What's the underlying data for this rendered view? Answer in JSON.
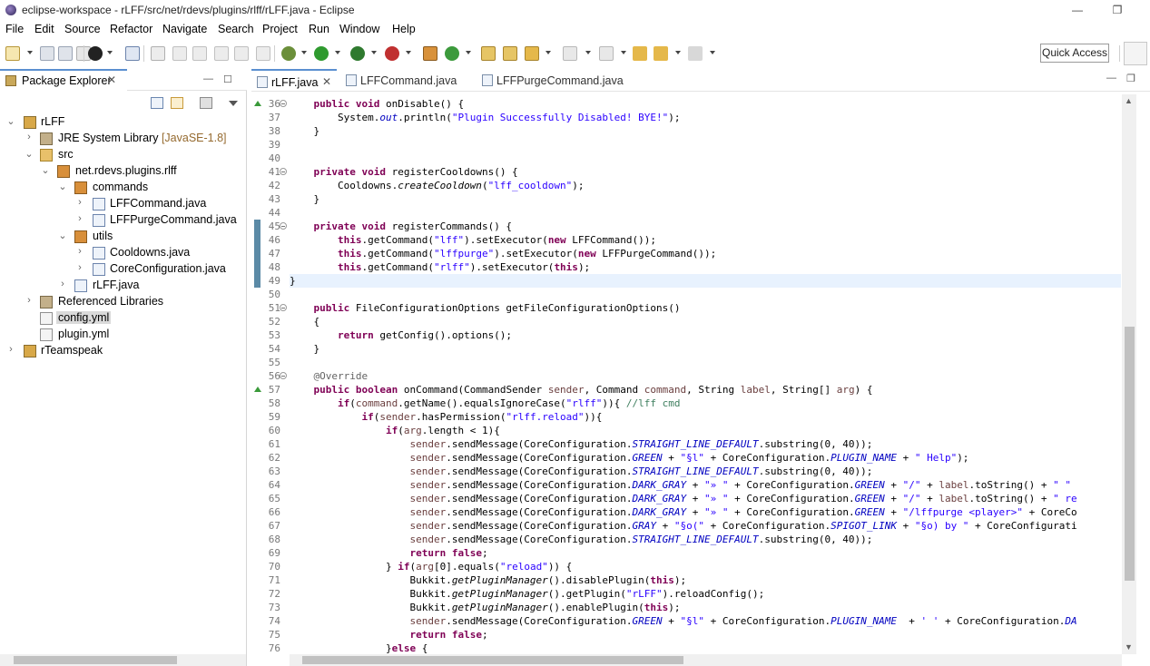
{
  "window": {
    "title": "eclipse-workspace - rLFF/src/net/rdevs/plugins/rlff/rLFF.java - Eclipse",
    "minimize": "—",
    "maximize": "❐"
  },
  "menu": [
    "File",
    "Edit",
    "Source",
    "Refactor",
    "Navigate",
    "Search",
    "Project",
    "Run",
    "Window",
    "Help"
  ],
  "toolbar": {
    "quick_access": "Quick Access"
  },
  "package_explorer": {
    "tab_label": "Package Explorer",
    "close": "✕",
    "minimize": "—",
    "maximize": "☐",
    "tree": [
      {
        "label": "rLFF",
        "deco": "",
        "arrow": "⌄",
        "icon": "project"
      },
      {
        "label": "JRE System Library",
        "deco": "[JavaSE-1.8]",
        "arrow": "›",
        "icon": "library"
      },
      {
        "label": "src",
        "deco": "",
        "arrow": "⌄",
        "icon": "source-folder"
      },
      {
        "label": "net.rdevs.plugins.rlff",
        "deco": "",
        "arrow": "⌄",
        "icon": "package"
      },
      {
        "label": "commands",
        "deco": "",
        "arrow": "⌄",
        "icon": "package"
      },
      {
        "label": "LFFCommand.java",
        "deco": "",
        "arrow": "›",
        "icon": "java-file"
      },
      {
        "label": "LFFPurgeCommand.java",
        "deco": "",
        "arrow": "›",
        "icon": "java-file"
      },
      {
        "label": "utils",
        "deco": "",
        "arrow": "⌄",
        "icon": "package"
      },
      {
        "label": "Cooldowns.java",
        "deco": "",
        "arrow": "›",
        "icon": "java-file"
      },
      {
        "label": "CoreConfiguration.java",
        "deco": "",
        "arrow": "›",
        "icon": "java-file"
      },
      {
        "label": "rLFF.java",
        "deco": "",
        "arrow": "›",
        "icon": "java-file"
      },
      {
        "label": "Referenced Libraries",
        "deco": "",
        "arrow": "›",
        "icon": "library"
      },
      {
        "label": "config.yml",
        "deco": "",
        "arrow": "",
        "icon": "yml-file"
      },
      {
        "label": "plugin.yml",
        "deco": "",
        "arrow": "",
        "icon": "yml-file"
      },
      {
        "label": "rTeamspeak",
        "deco": "",
        "arrow": "›",
        "icon": "project"
      }
    ]
  },
  "editor": {
    "tabs": [
      {
        "label": "rLFF.java",
        "active": true,
        "close": "✕"
      },
      {
        "label": "LFFCommand.java",
        "active": false
      },
      {
        "label": "LFFPurgeCommand.java",
        "active": false
      }
    ],
    "minimize": "—",
    "maximize": "❐",
    "line_numbers": [
      "36",
      "37",
      "38",
      "39",
      "40",
      "41",
      "42",
      "43",
      "44",
      "45",
      "46",
      "47",
      "48",
      "49",
      "50",
      "51",
      "52",
      "53",
      "54",
      "55",
      "56",
      "57",
      "58",
      "59",
      "60",
      "61",
      "62",
      "63",
      "64",
      "65",
      "66",
      "67",
      "68",
      "69",
      "70",
      "71",
      "72",
      "73",
      "74",
      "75",
      "76"
    ],
    "code": [
      "    public void onDisable() {",
      "        System.out.println(\"Plugin Successfully Disabled! BYE!\");",
      "    }",
      "",
      "",
      "    private void registerCooldowns() {",
      "        Cooldowns.createCooldown(\"lff_cooldown\");",
      "    }",
      "",
      "    private void registerCommands() {",
      "        this.getCommand(\"lff\").setExecutor(new LFFCommand());",
      "        this.getCommand(\"lffpurge\").setExecutor(new LFFPurgeCommand());",
      "        this.getCommand(\"rlff\").setExecutor(this);",
      "}",
      "",
      "    public FileConfigurationOptions getFileConfigurationOptions()",
      "    {",
      "        return getConfig().options();",
      "    }",
      "",
      "    @Override",
      "    public boolean onCommand(CommandSender sender, Command command, String label, String[] arg) {",
      "        if(command.getName().equalsIgnoreCase(\"rlff\")){ //lff cmd",
      "            if(sender.hasPermission(\"rlff.reload\")){",
      "                if(arg.length < 1){",
      "                    sender.sendMessage(CoreConfiguration.STRAIGHT_LINE_DEFAULT.substring(0, 40));",
      "                    sender.sendMessage(CoreConfiguration.GREEN + \"§l\" + CoreConfiguration.PLUGIN_NAME + \" Help\");",
      "                    sender.sendMessage(CoreConfiguration.STRAIGHT_LINE_DEFAULT.substring(0, 40));",
      "                    sender.sendMessage(CoreConfiguration.DARK_GRAY + \"» \" + CoreConfiguration.GREEN + \"/\" + label.toString() + \" \"",
      "                    sender.sendMessage(CoreConfiguration.DARK_GRAY + \"» \" + CoreConfiguration.GREEN + \"/\" + label.toString() + \" re",
      "                    sender.sendMessage(CoreConfiguration.DARK_GRAY + \"» \" + CoreConfiguration.GREEN + \"/lffpurge <player>\" + CoreCo",
      "                    sender.sendMessage(CoreConfiguration.GRAY + \"§o(\" + CoreConfiguration.SPIGOT_LINK + \"§o) by \" + CoreConfigurati",
      "                    sender.sendMessage(CoreConfiguration.STRAIGHT_LINE_DEFAULT.substring(0, 40));",
      "                    return false;",
      "                } if(arg[0].equals(\"reload\")) {",
      "                    Bukkit.getPluginManager().disablePlugin(this);",
      "                    Bukkit.getPluginManager().getPlugin(\"rLFF\").reloadConfig();",
      "                    Bukkit.getPluginManager().enablePlugin(this);",
      "                    sender.sendMessage(CoreConfiguration.GREEN + \"§l\" + CoreConfiguration.PLUGIN_NAME  + ' ' + CoreConfiguration.DA",
      "                    return false;",
      "                }else {"
    ]
  }
}
